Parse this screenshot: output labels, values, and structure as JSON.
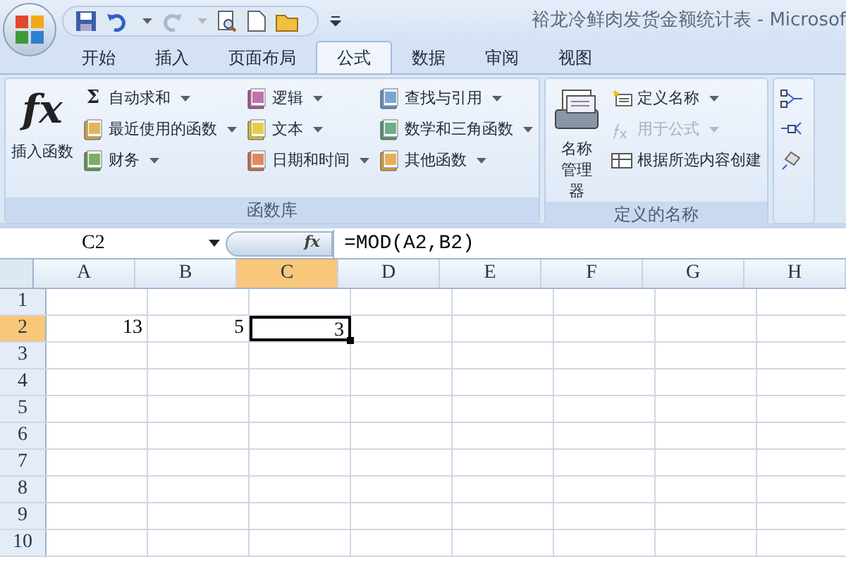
{
  "window": {
    "title": "裕龙冷鲜肉发货金额统计表 - Microsof"
  },
  "tabs": [
    {
      "label": "开始",
      "selected": false
    },
    {
      "label": "插入",
      "selected": false
    },
    {
      "label": "页面布局",
      "selected": false
    },
    {
      "label": "公式",
      "selected": true
    },
    {
      "label": "数据",
      "selected": false
    },
    {
      "label": "审阅",
      "selected": false
    },
    {
      "label": "视图",
      "selected": false
    }
  ],
  "ribbon": {
    "groups": [
      {
        "label": "函数库",
        "commands": [
          {
            "label": "插入函数",
            "kind": "large",
            "glyph": "fx",
            "dropdown": false,
            "disabled": false
          },
          {
            "label": "自动求和",
            "kind": "small",
            "glyph": "Σ",
            "dropdown": true,
            "disabled": false
          },
          {
            "label": "最近使用的函数",
            "kind": "small",
            "dropdown": true,
            "disabled": false
          },
          {
            "label": "财务",
            "kind": "small",
            "dropdown": true,
            "disabled": false
          },
          {
            "label": "逻辑",
            "kind": "small",
            "dropdown": true,
            "disabled": false
          },
          {
            "label": "文本",
            "kind": "small",
            "dropdown": true,
            "disabled": false
          },
          {
            "label": "日期和时间",
            "kind": "small",
            "dropdown": true,
            "disabled": false
          },
          {
            "label": "查找与引用",
            "kind": "small",
            "dropdown": true,
            "disabled": false
          },
          {
            "label": "数学和三角函数",
            "kind": "small",
            "dropdown": true,
            "disabled": false
          },
          {
            "label": "其他函数",
            "kind": "small",
            "dropdown": true,
            "disabled": false
          }
        ]
      },
      {
        "label": "定义的名称",
        "commands": [
          {
            "label": "名称管理器",
            "kind": "large",
            "dropdown": false,
            "disabled": false
          },
          {
            "label": "定义名称",
            "kind": "small",
            "dropdown": true,
            "disabled": false
          },
          {
            "label": "用于公式",
            "kind": "small",
            "dropdown": true,
            "disabled": true
          },
          {
            "label": "根据所选内容创建",
            "kind": "small",
            "dropdown": false,
            "disabled": false
          }
        ]
      }
    ]
  },
  "name_box": {
    "value": "C2"
  },
  "formula_bar": {
    "button": "fx",
    "value": "=MOD(A2,B2)"
  },
  "columns": [
    {
      "label": "A",
      "selected": false
    },
    {
      "label": "B",
      "selected": false
    },
    {
      "label": "C",
      "selected": true
    },
    {
      "label": "D",
      "selected": false
    },
    {
      "label": "E",
      "selected": false
    },
    {
      "label": "F",
      "selected": false
    },
    {
      "label": "G",
      "selected": false
    },
    {
      "label": "H",
      "selected": false
    }
  ],
  "rows": [
    {
      "label": "1",
      "selected": false
    },
    {
      "label": "2",
      "selected": true,
      "cells": [
        {
          "value": "13",
          "selected": false
        },
        {
          "value": "5",
          "selected": false
        },
        {
          "value": "3",
          "selected": true
        }
      ]
    },
    {
      "label": "3",
      "selected": false
    },
    {
      "label": "4",
      "selected": false
    },
    {
      "label": "5",
      "selected": false
    },
    {
      "label": "6",
      "selected": false
    },
    {
      "label": "7",
      "selected": false
    },
    {
      "label": "8",
      "selected": false
    },
    {
      "label": "9",
      "selected": false
    },
    {
      "label": "10",
      "selected": false
    }
  ]
}
